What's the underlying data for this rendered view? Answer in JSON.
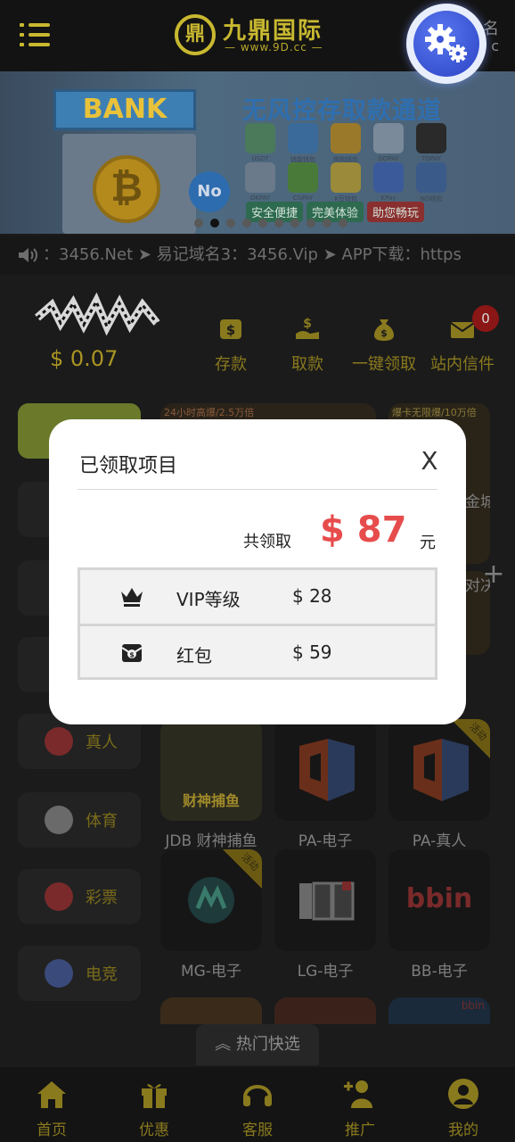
{
  "header": {
    "logo_mark": "鼎",
    "logo_text": "九鼎国际",
    "logo_url": "— www.9D.cc —",
    "corner_top": "名",
    "corner_bottom": "c"
  },
  "banner": {
    "bank_sign": "BANK",
    "coin_symbol": "₿",
    "no_badge": "No",
    "title": "无风控存取款通道",
    "wallets": [
      "USDT",
      "钱能钱包",
      "狗狗钱包",
      "GOPAY",
      "TOPAY",
      "OKPAY",
      "CGPAY",
      "K豆钱包",
      "KPay",
      "NO钱包"
    ],
    "tags": [
      "安全便捷",
      "完美体验",
      "助您畅玩"
    ]
  },
  "marquee": {
    "text": "：3456.Net  ➤ 易记域名3：3456.Vip  ➤ APP下载：https"
  },
  "account": {
    "balance": "$ 0.07",
    "actions": [
      "存款",
      "取款",
      "一键领取",
      "站内信件"
    ],
    "message_count": "0"
  },
  "sidebar": {
    "items": [
      {
        "label": "真人",
        "color": "#7a2a2a"
      },
      {
        "label": "体育",
        "color": "#6a6a6a"
      },
      {
        "label": "彩票",
        "color": "#7a2a2a"
      },
      {
        "label": "电竞",
        "color": "#3a4a7a"
      }
    ]
  },
  "games": [
    {
      "label": "JDB 财神捕鱼",
      "art": "财神捕鱼"
    },
    {
      "label": "PA-电子"
    },
    {
      "label": "PA-真人",
      "ribbon": "活动"
    },
    {
      "label": "MG-电子",
      "ribbon": "活动"
    },
    {
      "label": "LG-电子"
    },
    {
      "label": "BB-电子",
      "art": "bbin"
    }
  ],
  "partial_tiles": {
    "top_left": "24小时高爆/2.5万倍",
    "top_right": "爆卡无限爆/10万倍",
    "right_edge_1": "金城",
    "right_edge_2": "对决",
    "bottom_right": "bbin"
  },
  "hot_bar": {
    "label": "热门快选"
  },
  "bottom_nav": {
    "items": [
      "首页",
      "优惠",
      "客服",
      "推广",
      "我的"
    ]
  },
  "modal": {
    "title": "已领取项目",
    "close": "X",
    "total_label": "共领取",
    "total_amount": "$ 87",
    "total_unit": "元",
    "rows": [
      {
        "icon": "crown-icon",
        "name": "VIP等级",
        "amount": "$ 28"
      },
      {
        "icon": "red-envelope-icon",
        "name": "红包",
        "amount": "$ 59"
      }
    ]
  },
  "colors": {
    "accent_gold": "#c8b830",
    "total_red": "#e74c4c",
    "page_bg": "#1b1b1b"
  }
}
